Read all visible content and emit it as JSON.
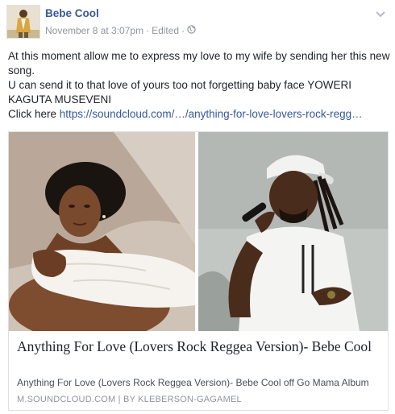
{
  "post": {
    "author": "Bebe Cool",
    "date": "November 8 at 3:07pm",
    "separator": "·",
    "edited": "Edited",
    "audience_icon": "globe-icon",
    "menu_icon": "chevron-down-icon"
  },
  "message": {
    "line1": "At this moment allow me to express my love to my wife by sending her this new song.",
    "line2": "U can send it to that love of yours too not forgetting baby face YOWERI KAGUTA MUSEVENI",
    "line3_prefix": "Click here ",
    "link": "https://soundcloud.com/…/anything-for-love-lovers-rock-regg…"
  },
  "link_card": {
    "title": "Anything For Love (Lovers Rock Reggea Version)- Bebe Cool",
    "description": "Anything For Love (Lovers Rock Reggea Version)- Bebe Cool off Go Mama Album",
    "source": "M.SOUNDCLOUD.COM",
    "source_separator": "|",
    "source_by": "BY KLEBERSON-GAGAMEL"
  },
  "colors": {
    "link": "#365899",
    "meta": "#90949c",
    "text": "#1d2129",
    "border": "#dddfe2"
  }
}
